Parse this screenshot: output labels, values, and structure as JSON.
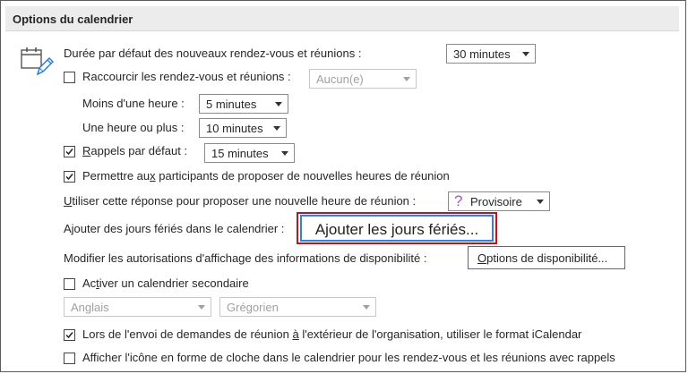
{
  "header": {
    "title": "Options du calendrier"
  },
  "default_duration": {
    "label": "Durée par défaut des nouveaux rendez-vous et réunions :",
    "value": "30 minutes"
  },
  "shorten": {
    "label_pre": "Raccourcir les rendez-vous et réunions :",
    "value": "Aucun(e)"
  },
  "under_hour": {
    "label": "Moins d'une heure :",
    "value": "5 minutes"
  },
  "over_hour": {
    "label": "Une heure ou plus :",
    "value": "10 minutes"
  },
  "reminders": {
    "label_u": "R",
    "label_rest": "appels par défaut :",
    "value": "15 minutes"
  },
  "propose_times": {
    "label_pre": "Permettre au",
    "label_u": "x",
    "label_post": " participants de proposer de nouvelles heures de réunion"
  },
  "response": {
    "label_u": "U",
    "label_rest": "tiliser cette réponse pour proposer une nouvelle heure de réunion :",
    "icon_char": "?",
    "value": "Provisoire"
  },
  "holidays": {
    "label": "Ajouter des jours fériés dans le calendrier :",
    "button": "Ajouter les jours fériés..."
  },
  "availability": {
    "label": "Modifier les autorisations d'affichage des informations de disponibilité :",
    "button_u": "O",
    "button_rest": "ptions de disponibilité..."
  },
  "secondary_cal": {
    "label_pre": "Ac",
    "label_u": "t",
    "label_post": "iver un calendrier secondaire",
    "language": "Anglais",
    "calendar": "Grégorien"
  },
  "icalendar": {
    "label_pre": "Lors de l'envoi de demandes de réunion ",
    "label_u": "à",
    "label_post": " l'extérieur de l'organisation, utiliser le format iCalendar"
  },
  "bell_icon": {
    "label": "Afficher l'icône en forme de cloche dans le calendrier pour les rendez-vous et les réunions avec rappels"
  },
  "colors": {
    "highlight_red": "#c0121f",
    "focus_blue": "#3b7dd8",
    "tentative_purple": "#b44ec6"
  }
}
